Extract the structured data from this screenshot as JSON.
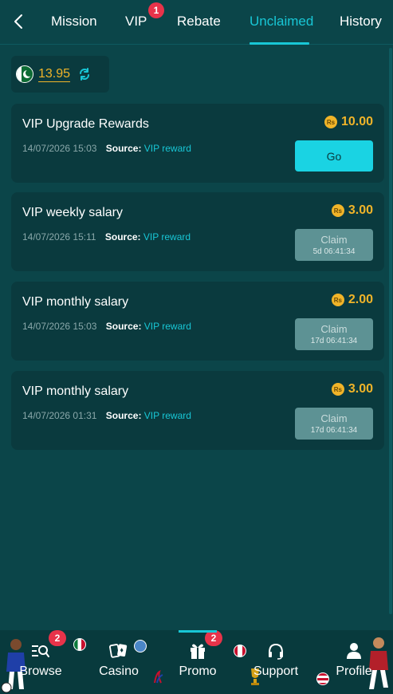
{
  "topnav": {
    "tabs": [
      {
        "label": "Mission",
        "active": false
      },
      {
        "label": "VIP",
        "active": false,
        "badge": "1"
      },
      {
        "label": "Rebate",
        "active": false
      },
      {
        "label": "Unclaimed",
        "active": true
      },
      {
        "label": "History",
        "active": false
      }
    ]
  },
  "balance": {
    "amount": "13.95",
    "flag_icon": "pakistan-flag-icon",
    "refresh_icon": "refresh-icon"
  },
  "rewards": [
    {
      "title": "VIP Upgrade Rewards",
      "date": "14/07/2026 15:03",
      "source_label": "Source:",
      "source_value": "VIP reward",
      "currency": "Rs",
      "amount": "10.00",
      "action": "Go",
      "timer": ""
    },
    {
      "title": "VIP weekly salary",
      "date": "14/07/2026 15:11",
      "source_label": "Source:",
      "source_value": "VIP reward",
      "currency": "Rs",
      "amount": "3.00",
      "action": "Claim",
      "timer": "5d 06:41:34"
    },
    {
      "title": "VIP monthly salary",
      "date": "14/07/2026 15:03",
      "source_label": "Source:",
      "source_value": "VIP reward",
      "currency": "Rs",
      "amount": "2.00",
      "action": "Claim",
      "timer": "17d 06:41:34"
    },
    {
      "title": "VIP monthly salary",
      "date": "14/07/2026 01:31",
      "source_label": "Source:",
      "source_value": "VIP reward",
      "currency": "Rs",
      "amount": "3.00",
      "action": "Claim",
      "timer": "17d 06:41:34"
    }
  ],
  "bottomnav": {
    "items": [
      {
        "label": "Browse",
        "icon": "browse-icon",
        "badge": "2"
      },
      {
        "label": "Casino",
        "icon": "cards-icon",
        "badge": ""
      },
      {
        "label": "Promo",
        "icon": "gift-icon",
        "badge": "2",
        "active": true
      },
      {
        "label": "Support",
        "icon": "headset-icon",
        "badge": ""
      },
      {
        "label": "Profile",
        "icon": "user-icon",
        "badge": ""
      }
    ]
  },
  "colors": {
    "background": "#0b4549",
    "card": "#0a3a3e",
    "accent": "#18c7d6",
    "gold": "#f0b429",
    "badge": "#e8334a",
    "claim_disabled": "#5d9294"
  }
}
